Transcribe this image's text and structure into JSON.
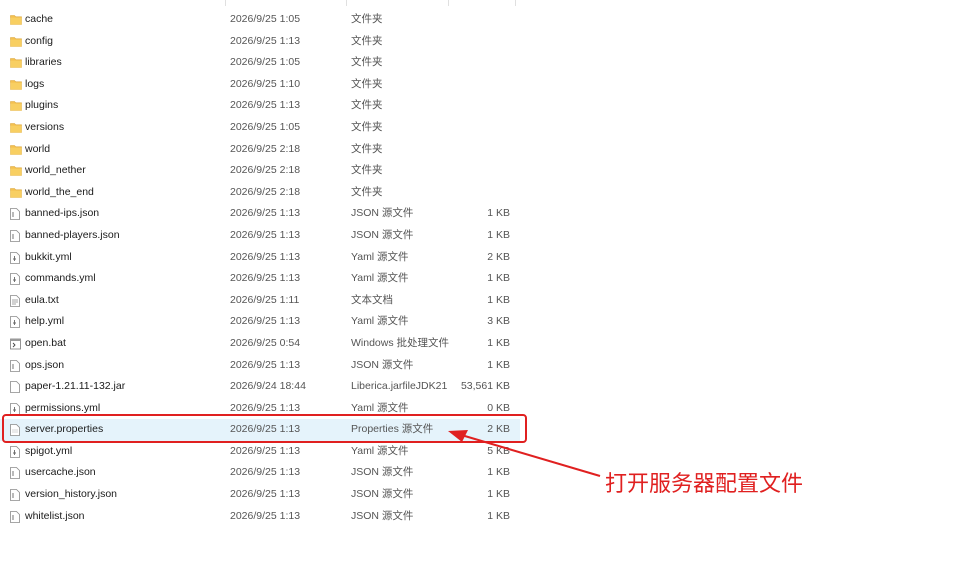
{
  "files": [
    {
      "name": "cache",
      "date": "2026/9/25 1:05",
      "type": "文件夹",
      "size": "",
      "icon": "folder-icon"
    },
    {
      "name": "config",
      "date": "2026/9/25 1:13",
      "type": "文件夹",
      "size": "",
      "icon": "folder-icon"
    },
    {
      "name": "libraries",
      "date": "2026/9/25 1:05",
      "type": "文件夹",
      "size": "",
      "icon": "folder-icon"
    },
    {
      "name": "logs",
      "date": "2026/9/25 1:10",
      "type": "文件夹",
      "size": "",
      "icon": "folder-icon"
    },
    {
      "name": "plugins",
      "date": "2026/9/25 1:13",
      "type": "文件夹",
      "size": "",
      "icon": "folder-icon"
    },
    {
      "name": "versions",
      "date": "2026/9/25 1:05",
      "type": "文件夹",
      "size": "",
      "icon": "folder-icon"
    },
    {
      "name": "world",
      "date": "2026/9/25 2:18",
      "type": "文件夹",
      "size": "",
      "icon": "folder-icon"
    },
    {
      "name": "world_nether",
      "date": "2026/9/25 2:18",
      "type": "文件夹",
      "size": "",
      "icon": "folder-icon"
    },
    {
      "name": "world_the_end",
      "date": "2026/9/25 2:18",
      "type": "文件夹",
      "size": "",
      "icon": "folder-icon"
    },
    {
      "name": "banned-ips.json",
      "date": "2026/9/25 1:13",
      "type": "JSON 源文件",
      "size": "1 KB",
      "icon": "json-file-icon"
    },
    {
      "name": "banned-players.json",
      "date": "2026/9/25 1:13",
      "type": "JSON 源文件",
      "size": "1 KB",
      "icon": "json-file-icon"
    },
    {
      "name": "bukkit.yml",
      "date": "2026/9/25 1:13",
      "type": "Yaml 源文件",
      "size": "2 KB",
      "icon": "yaml-file-icon"
    },
    {
      "name": "commands.yml",
      "date": "2026/9/25 1:13",
      "type": "Yaml 源文件",
      "size": "1 KB",
      "icon": "yaml-file-icon"
    },
    {
      "name": "eula.txt",
      "date": "2026/9/25 1:11",
      "type": "文本文档",
      "size": "1 KB",
      "icon": "text-file-icon"
    },
    {
      "name": "help.yml",
      "date": "2026/9/25 1:13",
      "type": "Yaml 源文件",
      "size": "3 KB",
      "icon": "yaml-file-icon"
    },
    {
      "name": "open.bat",
      "date": "2026/9/25 0:54",
      "type": "Windows 批处理文件",
      "size": "1 KB",
      "icon": "batch-file-icon"
    },
    {
      "name": "ops.json",
      "date": "2026/9/25 1:13",
      "type": "JSON 源文件",
      "size": "1 KB",
      "icon": "json-file-icon"
    },
    {
      "name": "paper-1.21.11-132.jar",
      "date": "2026/9/24 18:44",
      "type": "Liberica.jarfileJDK21",
      "size": "53,561 KB",
      "icon": "jar-file-icon"
    },
    {
      "name": "permissions.yml",
      "date": "2026/9/25 1:13",
      "type": "Yaml 源文件",
      "size": "0 KB",
      "icon": "yaml-file-icon"
    },
    {
      "name": "server.properties",
      "date": "2026/9/25 1:13",
      "type": "Properties 源文件",
      "size": "2 KB",
      "icon": "properties-file-icon",
      "selected": true
    },
    {
      "name": "spigot.yml",
      "date": "2026/9/25 1:13",
      "type": "Yaml 源文件",
      "size": "5 KB",
      "icon": "yaml-file-icon"
    },
    {
      "name": "usercache.json",
      "date": "2026/9/25 1:13",
      "type": "JSON 源文件",
      "size": "1 KB",
      "icon": "json-file-icon"
    },
    {
      "name": "version_history.json",
      "date": "2026/9/25 1:13",
      "type": "JSON 源文件",
      "size": "1 KB",
      "icon": "json-file-icon"
    },
    {
      "name": "whitelist.json",
      "date": "2026/9/25 1:13",
      "type": "JSON 源文件",
      "size": "1 KB",
      "icon": "json-file-icon"
    }
  ],
  "annotation": {
    "text": "打开服务器配置文件",
    "color": "#e02020"
  },
  "colors": {
    "folder": "#f4c150",
    "selected_row": "#e5f3fb",
    "highlight": "#e02020"
  }
}
